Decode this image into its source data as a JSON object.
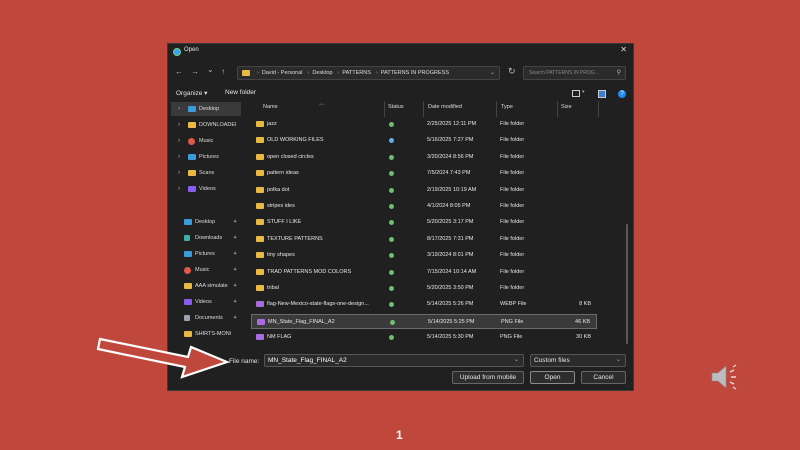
{
  "dialog": {
    "title": "Open",
    "close_glyph": "✕"
  },
  "nav": {
    "back": "←",
    "forward": "→",
    "recent": "⌄",
    "up": "↑",
    "breadcrumbs": [
      "David - Personal",
      "Desktop",
      "PATTERNS",
      "PATTERNS IN PROGRESS"
    ],
    "breadcrumb_sep": "›",
    "dropdown": "⌄",
    "refresh": "↻",
    "search_placeholder": "Search PATTERNS IN PROG...",
    "search_glyph": "⚲"
  },
  "toolbar": {
    "organize": "Organize ▾",
    "new_folder": "New folder",
    "view_dd": "▾",
    "help": "?"
  },
  "sidebar": {
    "tree": [
      {
        "label": "Desktop",
        "icon": "desktop-icon",
        "color": "#3a9bdc",
        "selected": true
      },
      {
        "label": "DOWNLOADEI",
        "icon": "folder-icon",
        "color": "#e9b943"
      },
      {
        "label": "Music",
        "icon": "music-icon",
        "color": "#e0584a"
      },
      {
        "label": "Pictures",
        "icon": "pictures-icon",
        "color": "#3a9bdc"
      },
      {
        "label": "Scans",
        "icon": "folder-icon",
        "color": "#e9b943"
      },
      {
        "label": "Videos",
        "icon": "videos-icon",
        "color": "#8a5cf0"
      }
    ],
    "quick_access": [
      {
        "label": "Desktop",
        "icon": "desktop-icon",
        "color": "#3a9bdc"
      },
      {
        "label": "Downloads",
        "icon": "downloads-icon",
        "color": "#3ab0a8"
      },
      {
        "label": "Pictures",
        "icon": "pictures-icon",
        "color": "#3a9bdc"
      },
      {
        "label": "Music",
        "icon": "music-icon",
        "color": "#e0584a"
      },
      {
        "label": "AAA simulate",
        "icon": "folder-icon",
        "color": "#e9b943"
      },
      {
        "label": "Videos",
        "icon": "videos-icon",
        "color": "#8a5cf0"
      },
      {
        "label": "Documents",
        "icon": "documents-icon",
        "color": "#9aa3ad"
      },
      {
        "label": "SHIRTS-MONOG",
        "icon": "folder-icon",
        "color": "#e9b943"
      }
    ],
    "pin_glyph": "📌"
  },
  "columns": {
    "name": "Name",
    "status": "Status",
    "date": "Date modified",
    "type": "Type",
    "size": "Size"
  },
  "files": [
    {
      "name": "jazz",
      "date": "2/25/2025 12:11 PM",
      "type": "File folder",
      "size": "",
      "kind": "folder",
      "status": "synced"
    },
    {
      "name": "OLD WORKING FILES",
      "date": "5/16/2025 7:27 PM",
      "type": "File folder",
      "size": "",
      "kind": "folder",
      "status": "cloud"
    },
    {
      "name": "open closed circles",
      "date": "3/20/2024 8:56 PM",
      "type": "File folder",
      "size": "",
      "kind": "folder",
      "status": "synced"
    },
    {
      "name": "pattern ideas",
      "date": "7/5/2024 7:43 PM",
      "type": "File folder",
      "size": "",
      "kind": "folder",
      "status": "synced"
    },
    {
      "name": "polka dot",
      "date": "2/19/2025 10:19 AM",
      "type": "File folder",
      "size": "",
      "kind": "folder",
      "status": "synced"
    },
    {
      "name": "stripes ides",
      "date": "4/1/2024 8:05 PM",
      "type": "File folder",
      "size": "",
      "kind": "folder",
      "status": "synced"
    },
    {
      "name": "STUFF I LIKE",
      "date": "5/20/2025 3:17 PM",
      "type": "File folder",
      "size": "",
      "kind": "folder",
      "status": "synced"
    },
    {
      "name": "TEXTURE PATTERNS",
      "date": "8/17/2025 7:31 PM",
      "type": "File folder",
      "size": "",
      "kind": "folder",
      "status": "synced"
    },
    {
      "name": "tiny shapes",
      "date": "3/19/2024 8:01 PM",
      "type": "File folder",
      "size": "",
      "kind": "folder",
      "status": "synced"
    },
    {
      "name": "TRAD PATTERNS MOD COLORS",
      "date": "7/15/2024 10:14 AM",
      "type": "File folder",
      "size": "",
      "kind": "folder",
      "status": "synced"
    },
    {
      "name": "tribal",
      "date": "5/20/2025 3:50 PM",
      "type": "File folder",
      "size": "",
      "kind": "folder",
      "status": "synced"
    },
    {
      "name": "flag-New-Mexico-state-flags-one-design...",
      "date": "5/14/2025 5:26 PM",
      "type": "WEBP File",
      "size": "8 KB",
      "kind": "image",
      "status": "synced"
    },
    {
      "name": "MN_State_Flag_FINAL_A2",
      "date": "5/14/2025 5:25 PM",
      "type": "PNG File",
      "size": "46 KB",
      "kind": "image",
      "status": "synced",
      "selected": true
    },
    {
      "name": "NM FLAG",
      "date": "5/14/2025 5:30 PM",
      "type": "PNG File",
      "size": "30 KB",
      "kind": "image",
      "status": "synced"
    }
  ],
  "colors": {
    "folder": "#e9b943",
    "image": "#a86ce0",
    "synced": "#6cc070",
    "cloud": "#5fb0f0"
  },
  "footer": {
    "file_name_label": "File name:",
    "file_name_value": "MN_State_Flag_FINAL_A2",
    "file_type_value": "Custom files",
    "dropdown": "⌄",
    "upload_label": "Upload from mobile",
    "open_label": "Open",
    "cancel_label": "Cancel",
    "resize_glyph": "⋰"
  },
  "slide": {
    "number": "1"
  }
}
